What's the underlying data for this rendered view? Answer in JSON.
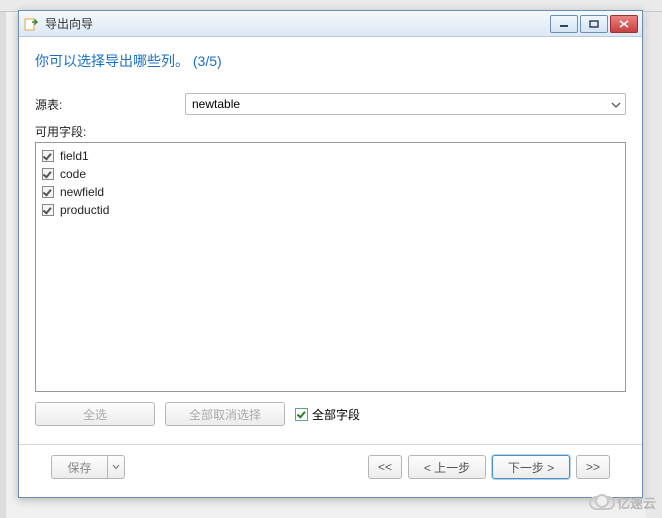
{
  "window": {
    "title": "导出向导"
  },
  "heading": "你可以选择导出哪些列。 (3/5)",
  "source": {
    "label": "源表:",
    "value": "newtable"
  },
  "fields_label": "可用字段:",
  "fields": [
    {
      "name": "field1",
      "checked": true
    },
    {
      "name": "code",
      "checked": true
    },
    {
      "name": "newfield",
      "checked": true
    },
    {
      "name": "productid",
      "checked": true
    }
  ],
  "buttons": {
    "select_all": "全选",
    "deselect_all": "全部取消选择",
    "all_fields": "全部字段",
    "save": "保存",
    "first": "<<",
    "prev": "< 上一步",
    "next": "下一步 >",
    "last": ">>"
  },
  "all_fields_checked": true,
  "watermark": "亿速云"
}
